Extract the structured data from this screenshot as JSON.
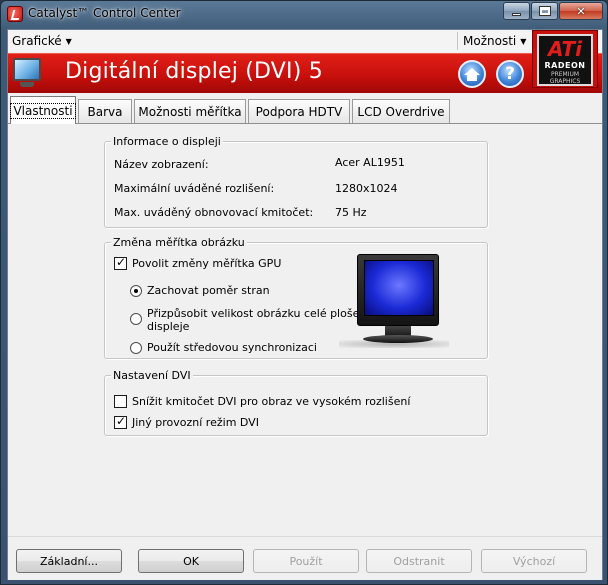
{
  "window": {
    "title": "Catalyst™ Control Center"
  },
  "menubar": {
    "left_menu": "Grafické",
    "right_menu": "Možnosti"
  },
  "header": {
    "title": "Digitální displej (DVI) 5",
    "help_glyph": "?"
  },
  "logo": {
    "brand": "ATi",
    "product": "RADEON",
    "sub_line1": "PREMIUM",
    "sub_line2": "GRAPHICS"
  },
  "tabs": [
    {
      "label": "Vlastnosti",
      "active": true
    },
    {
      "label": "Barva",
      "active": false
    },
    {
      "label": "Možnosti měřítka",
      "active": false
    },
    {
      "label": "Podpora HDTV",
      "active": false
    },
    {
      "label": "LCD Overdrive",
      "active": false
    }
  ],
  "display_info": {
    "group_title": "Informace o displeji",
    "rows": [
      {
        "label": "Název zobrazení:",
        "value": "Acer AL1951"
      },
      {
        "label": "Maximální uváděné rozlišení:",
        "value": "1280x1024"
      },
      {
        "label": "Max. uváděný obnovovací kmitočet:",
        "value": "75 Hz"
      }
    ]
  },
  "scaling": {
    "group_title": "Změna měřítka obrázku",
    "enable_gpu_scaling": {
      "label": "Povolit změny měřítka GPU",
      "checked": true
    },
    "options": [
      {
        "label": "Zachovat poměr stran",
        "checked": true
      },
      {
        "label": "Přizpůsobit velikost obrázku celé ploše",
        "label2": "displeje",
        "checked": false
      },
      {
        "label": "Použít středovou synchronizaci",
        "checked": false
      }
    ]
  },
  "dvi": {
    "group_title": "Nastavení DVI",
    "options": [
      {
        "label": "Snížit kmitočet DVI pro obraz ve vysokém rozlišení",
        "checked": false
      },
      {
        "label": "Jiný provozní režim DVI",
        "checked": true
      }
    ]
  },
  "buttons": {
    "basic": "Základní...",
    "ok": "OK",
    "apply": "Použít",
    "discard": "Odstranit",
    "defaults": "Výchozí"
  },
  "colors": {
    "header_red": "#c8100c",
    "panel_bg": "#f0f0f0"
  }
}
